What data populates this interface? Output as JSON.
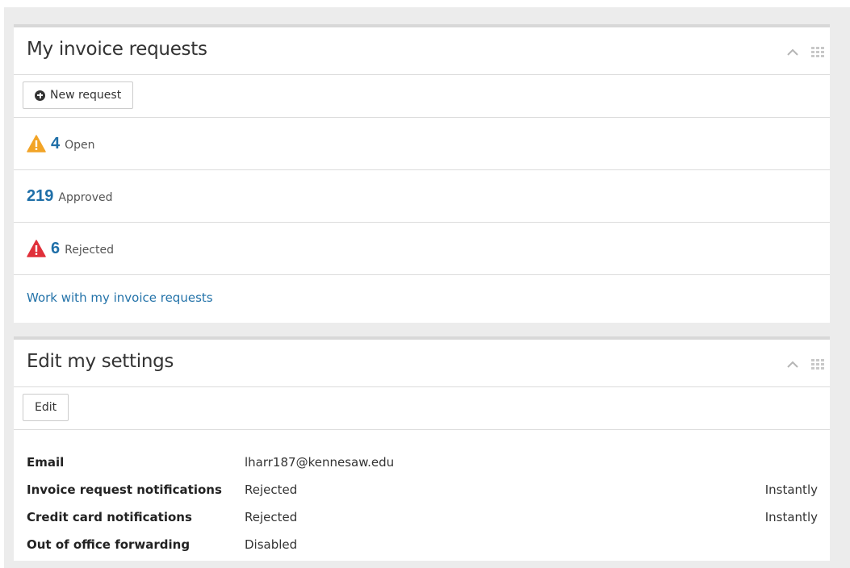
{
  "invoices_panel": {
    "title": "My invoice requests",
    "new_request_label": "New request",
    "stats": [
      {
        "count": "4",
        "label": "Open",
        "status": "warning",
        "icon": "warning-icon"
      },
      {
        "count": "219",
        "label": "Approved",
        "status": "none",
        "icon": ""
      },
      {
        "count": "6",
        "label": "Rejected",
        "status": "error",
        "icon": "alert-icon"
      }
    ],
    "work_link": "Work with my invoice requests"
  },
  "settings_panel": {
    "title": "Edit my settings",
    "edit_label": "Edit",
    "rows": [
      {
        "key": "Email",
        "value": "lharr187@kennesaw.edu",
        "frequency": ""
      },
      {
        "key": "Invoice request notifications",
        "value": "Rejected",
        "frequency": "Instantly"
      },
      {
        "key": "Credit card notifications",
        "value": "Rejected",
        "frequency": "Instantly"
      },
      {
        "key": "Out of office forwarding",
        "value": "Disabled",
        "frequency": ""
      }
    ]
  },
  "colors": {
    "accent_blue": "#1f6fa8",
    "warning_orange": "#f2a427",
    "error_red": "#e0303a",
    "panel_border": "#d8d8d8"
  },
  "icons": [
    "chevron-up-icon",
    "grid-icon",
    "plus-circle-icon",
    "warning-icon",
    "alert-icon"
  ]
}
